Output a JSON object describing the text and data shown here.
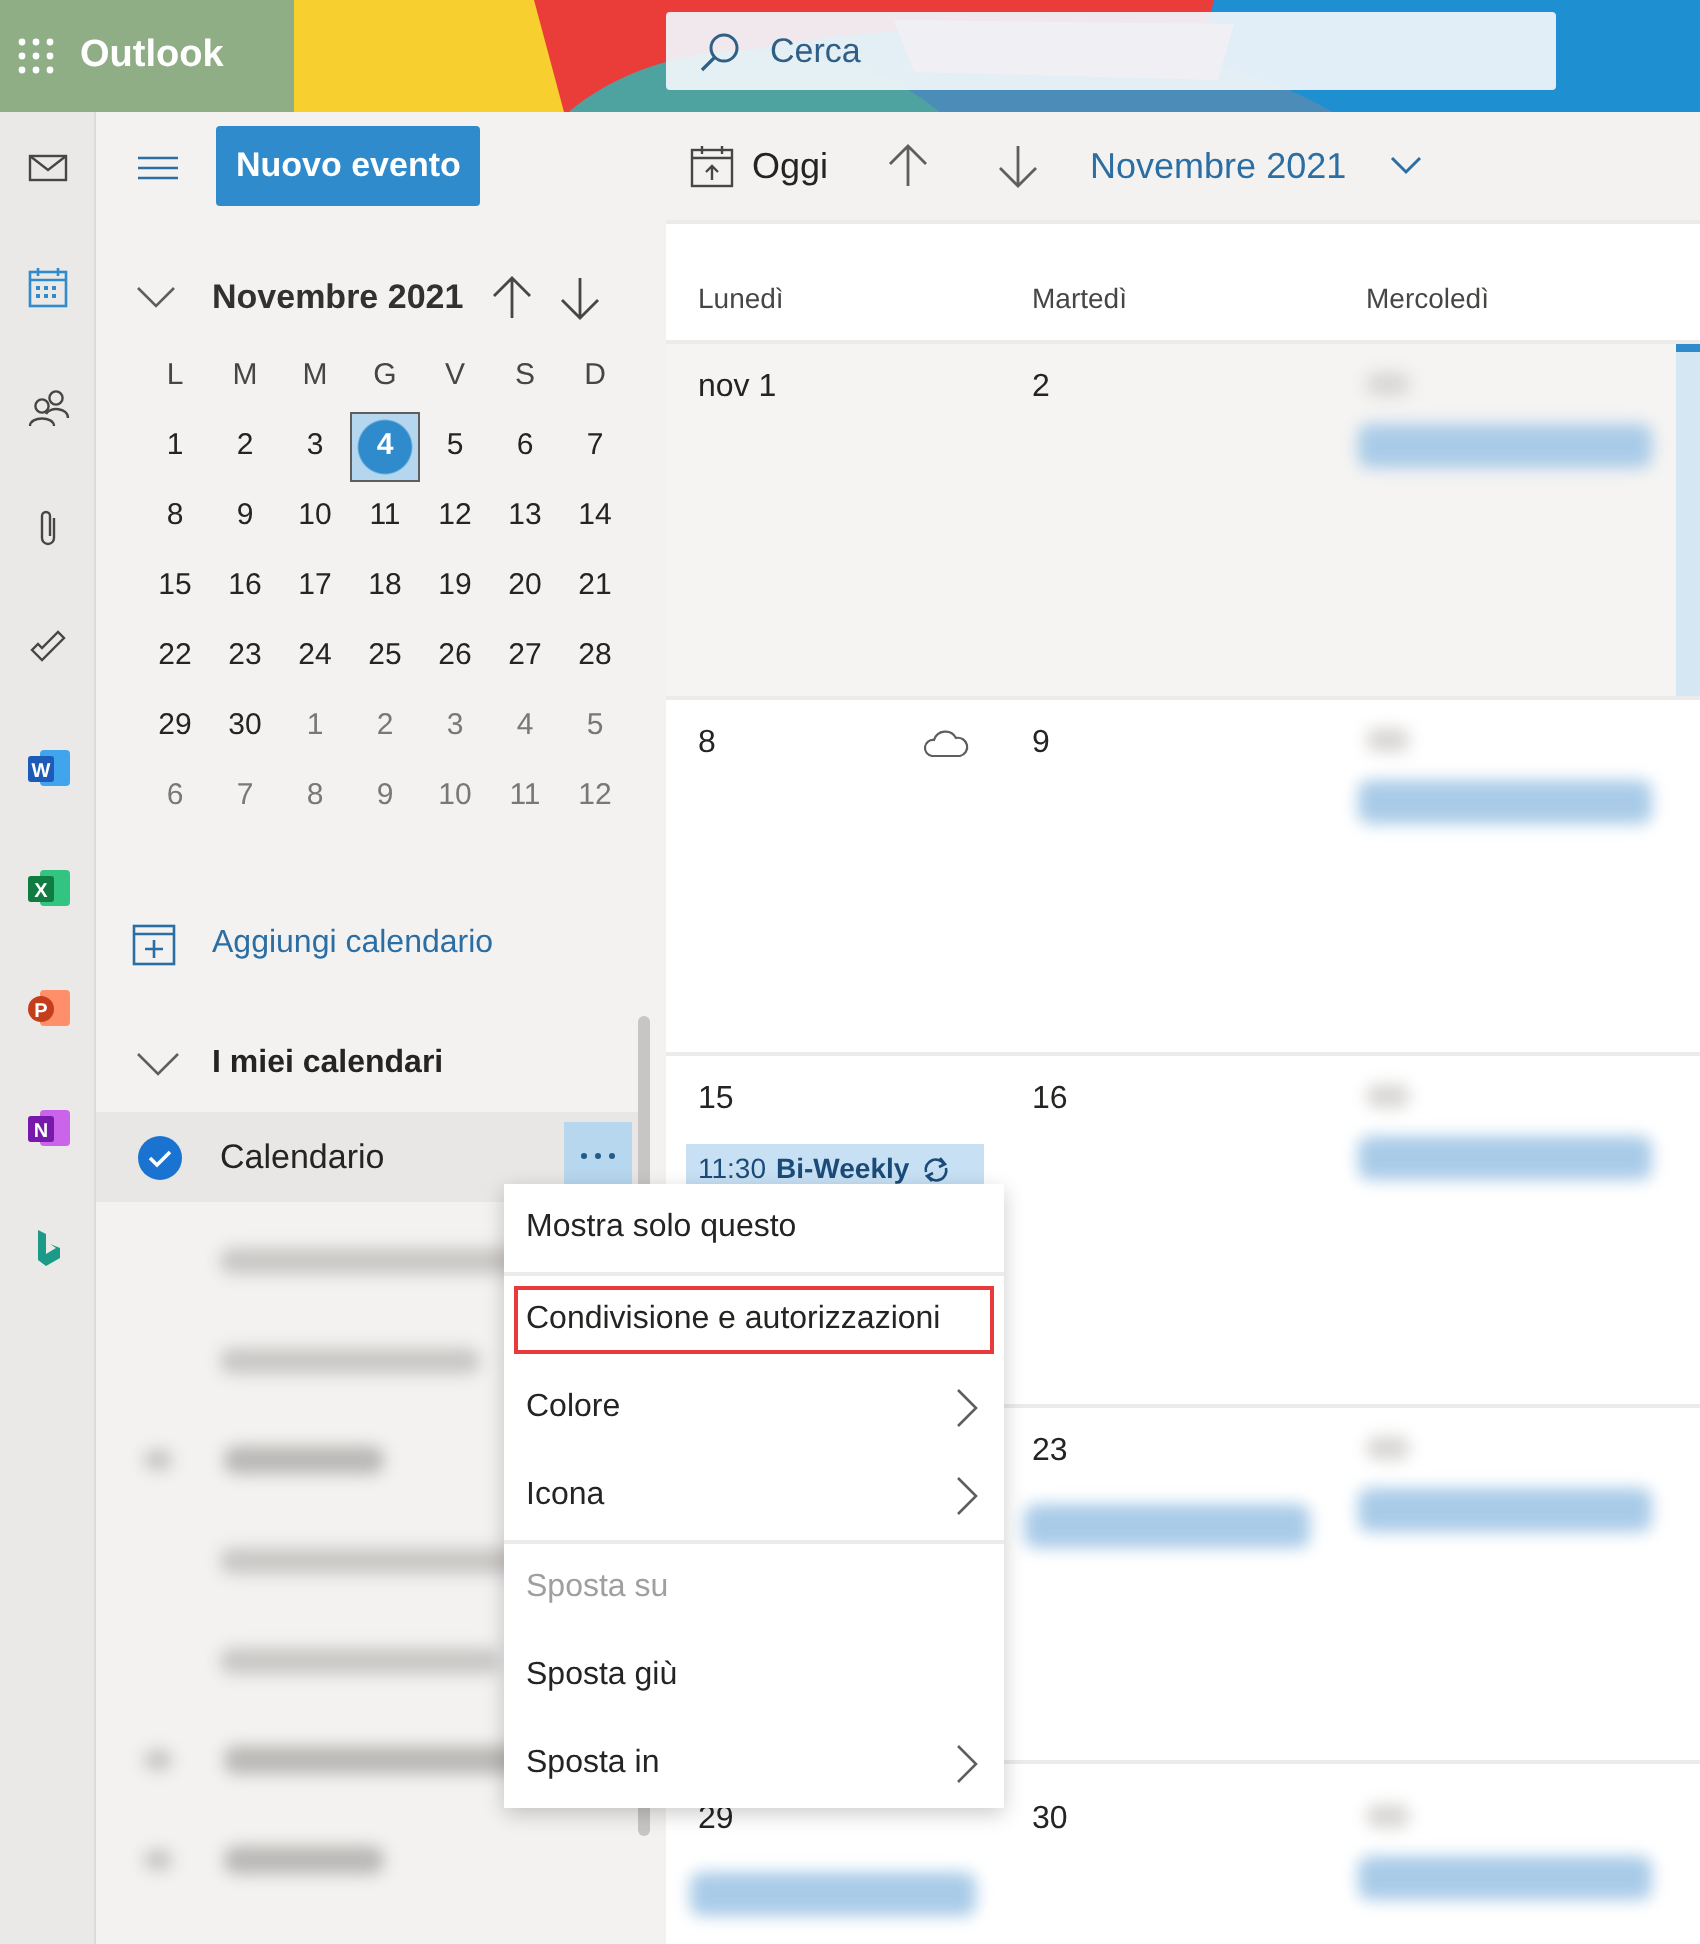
{
  "header": {
    "app_name": "Outlook",
    "search": {
      "placeholder": "Cerca"
    }
  },
  "rail": [
    {
      "kind": "mail",
      "selected": false
    },
    {
      "kind": "calendar",
      "selected": true
    },
    {
      "kind": "people",
      "selected": false
    },
    {
      "kind": "files",
      "selected": false
    },
    {
      "kind": "todo",
      "selected": false
    },
    {
      "kind": "word",
      "letter": "W"
    },
    {
      "kind": "excel",
      "letter": "X"
    },
    {
      "kind": "powerpoint",
      "letter": "P"
    },
    {
      "kind": "onenote",
      "letter": "N"
    },
    {
      "kind": "bing"
    }
  ],
  "sidebar": {
    "new_event_button": "Nuovo evento",
    "mini_calendar": {
      "title": "Novembre 2021",
      "weekdays": [
        "L",
        "M",
        "M",
        "G",
        "V",
        "S",
        "D"
      ],
      "weeks": [
        [
          {
            "d": "1",
            "muted": false,
            "selected": false
          },
          {
            "d": "2",
            "muted": false,
            "selected": false
          },
          {
            "d": "3",
            "muted": false,
            "selected": false
          },
          {
            "d": "4",
            "muted": false,
            "selected": true
          },
          {
            "d": "5",
            "muted": false,
            "selected": false
          },
          {
            "d": "6",
            "muted": false,
            "selected": false
          },
          {
            "d": "7",
            "muted": false,
            "selected": false
          }
        ],
        [
          {
            "d": "8",
            "muted": false,
            "selected": false
          },
          {
            "d": "9",
            "muted": false,
            "selected": false
          },
          {
            "d": "10",
            "muted": false,
            "selected": false
          },
          {
            "d": "11",
            "muted": false,
            "selected": false
          },
          {
            "d": "12",
            "muted": false,
            "selected": false
          },
          {
            "d": "13",
            "muted": false,
            "selected": false
          },
          {
            "d": "14",
            "muted": false,
            "selected": false
          }
        ],
        [
          {
            "d": "15",
            "muted": false,
            "selected": false
          },
          {
            "d": "16",
            "muted": false,
            "selected": false
          },
          {
            "d": "17",
            "muted": false,
            "selected": false
          },
          {
            "d": "18",
            "muted": false,
            "selected": false
          },
          {
            "d": "19",
            "muted": false,
            "selected": false
          },
          {
            "d": "20",
            "muted": false,
            "selected": false
          },
          {
            "d": "21",
            "muted": false,
            "selected": false
          }
        ],
        [
          {
            "d": "22",
            "muted": false,
            "selected": false
          },
          {
            "d": "23",
            "muted": false,
            "selected": false
          },
          {
            "d": "24",
            "muted": false,
            "selected": false
          },
          {
            "d": "25",
            "muted": false,
            "selected": false
          },
          {
            "d": "26",
            "muted": false,
            "selected": false
          },
          {
            "d": "27",
            "muted": false,
            "selected": false
          },
          {
            "d": "28",
            "muted": false,
            "selected": false
          }
        ],
        [
          {
            "d": "29",
            "muted": false,
            "selected": false
          },
          {
            "d": "30",
            "muted": false,
            "selected": false
          },
          {
            "d": "1",
            "muted": true,
            "selected": false
          },
          {
            "d": "2",
            "muted": true,
            "selected": false
          },
          {
            "d": "3",
            "muted": true,
            "selected": false
          },
          {
            "d": "4",
            "muted": true,
            "selected": false
          },
          {
            "d": "5",
            "muted": true,
            "selected": false
          }
        ],
        [
          {
            "d": "6",
            "muted": true,
            "selected": false
          },
          {
            "d": "7",
            "muted": true,
            "selected": false
          },
          {
            "d": "8",
            "muted": true,
            "selected": false
          },
          {
            "d": "9",
            "muted": true,
            "selected": false
          },
          {
            "d": "10",
            "muted": true,
            "selected": false
          },
          {
            "d": "11",
            "muted": true,
            "selected": false
          },
          {
            "d": "12",
            "muted": true,
            "selected": false
          }
        ]
      ]
    },
    "add_calendar": "Aggiungi calendario",
    "group_title": "I miei calendari",
    "group_expanded": true,
    "calendar": {
      "name": "Calendario",
      "checked": true
    },
    "blurred_items": [
      {
        "kind": "item"
      },
      {
        "kind": "item"
      },
      {
        "kind": "group"
      },
      {
        "kind": "item"
      },
      {
        "kind": "item"
      },
      {
        "kind": "group"
      },
      {
        "kind": "group"
      }
    ]
  },
  "context_menu": [
    {
      "label": "Mostra solo questo",
      "disabled": false,
      "submenu": false,
      "highlighted": false,
      "divider_after": true
    },
    {
      "label": "Condivisione e autorizzazioni",
      "disabled": false,
      "submenu": false,
      "highlighted": true,
      "divider_after": false
    },
    {
      "label": "Colore",
      "disabled": false,
      "submenu": true,
      "highlighted": false,
      "divider_after": false
    },
    {
      "label": "Icona",
      "disabled": false,
      "submenu": true,
      "highlighted": false,
      "divider_after": true
    },
    {
      "label": "Sposta su",
      "disabled": true,
      "submenu": false,
      "highlighted": false,
      "divider_after": false
    },
    {
      "label": "Sposta giù",
      "disabled": false,
      "submenu": false,
      "highlighted": false,
      "divider_after": false
    },
    {
      "label": "Sposta in",
      "disabled": false,
      "submenu": true,
      "highlighted": false,
      "divider_after": false
    }
  ],
  "toolbar": {
    "today": "Oggi",
    "period": "Novembre 2021"
  },
  "month_view": {
    "day_headers": [
      "Lunedì",
      "Martedì",
      "Mercoledì"
    ],
    "weeks": [
      {
        "past": true,
        "cells": [
          {
            "kind": "day",
            "date": "nov 1"
          },
          {
            "kind": "day",
            "date": "2"
          },
          {
            "kind": "blurred"
          },
          {
            "kind": "today"
          }
        ]
      },
      {
        "past": false,
        "cells": [
          {
            "kind": "day",
            "date": "8",
            "weather": true
          },
          {
            "kind": "day",
            "date": "9"
          },
          {
            "kind": "blurred"
          },
          {
            "kind": "empty"
          }
        ]
      },
      {
        "past": false,
        "cells": [
          {
            "kind": "day",
            "date": "15",
            "events": [
              {
                "kind": "event",
                "time": "11:30",
                "title": "Bi-Weekly",
                "recurring": true
              }
            ]
          },
          {
            "kind": "day",
            "date": "16"
          },
          {
            "kind": "blurred"
          },
          {
            "kind": "empty"
          }
        ]
      },
      {
        "past": false,
        "cells": [
          {
            "kind": "empty"
          },
          {
            "kind": "day",
            "date": "23",
            "events": [
              {
                "kind": "blurred"
              }
            ]
          },
          {
            "kind": "blurred"
          },
          {
            "kind": "empty"
          }
        ]
      },
      {
        "past": false,
        "cells": [
          {
            "kind": "day",
            "date": "29",
            "events": [
              {
                "kind": "blurred"
              }
            ]
          },
          {
            "kind": "day",
            "date": "30"
          },
          {
            "kind": "blurred"
          },
          {
            "kind": "empty"
          }
        ]
      }
    ]
  }
}
